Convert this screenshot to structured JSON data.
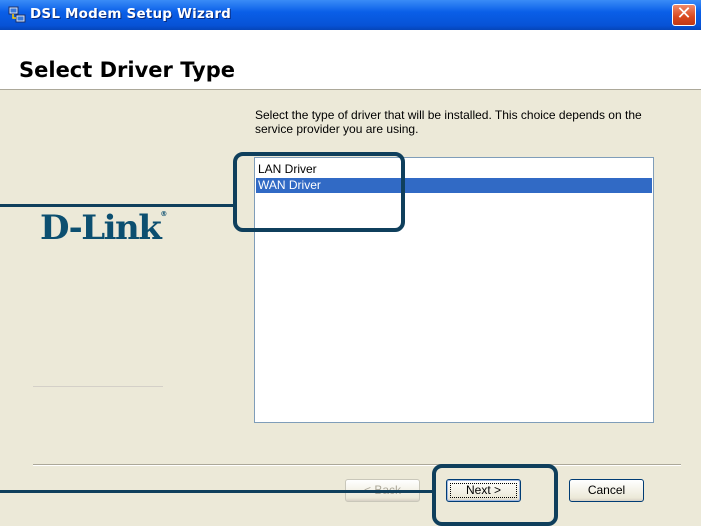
{
  "window": {
    "title": "DSL Modem Setup Wizard",
    "close_symbol": "✕"
  },
  "header": {
    "title": "Select Driver Type"
  },
  "logo": {
    "brand": "D-Link",
    "trademark": "®"
  },
  "content": {
    "instruction": "Select the type of driver that will be installed.  This choice depends on the service provider you are using.",
    "driver_list": {
      "items": [
        {
          "label": "LAN Driver",
          "selected": false
        },
        {
          "label": "WAN Driver",
          "selected": true
        }
      ]
    }
  },
  "buttons": {
    "back": "< Back",
    "next": "Next >",
    "cancel": "Cancel"
  },
  "colors": {
    "titlebar": "#0752d6",
    "selection": "#316ac5",
    "callout": "#0f3f5c",
    "logo": "#0c4f70"
  },
  "icons": {
    "app_icon": "network-computers-icon",
    "close_icon": "close-icon"
  }
}
